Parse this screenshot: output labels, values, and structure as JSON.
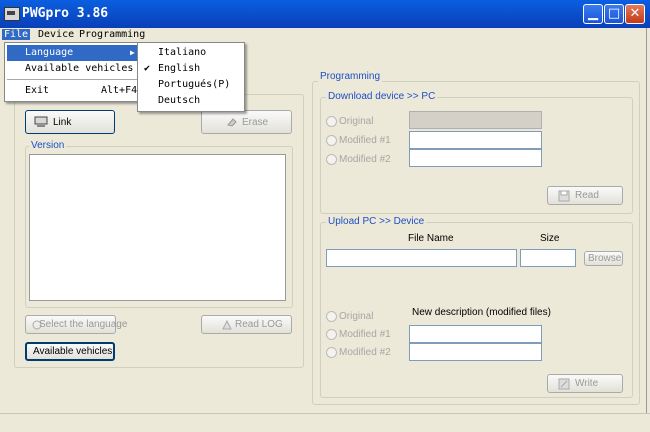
{
  "window": {
    "title": "PWGpro 3.86"
  },
  "menubar": {
    "file": "File",
    "device": "Device",
    "programming": "Programming"
  },
  "file_menu": {
    "language": "Language",
    "available_vehicles": "Available vehicles",
    "exit": "Exit",
    "exit_shortcut": "Alt+F4"
  },
  "language_menu": {
    "italiano": "Italiano",
    "english": "English",
    "portugues": "Portugués(P)",
    "deutsch": "Deutsch",
    "checked": "English"
  },
  "left": {
    "link": "Link",
    "erase": "Erase",
    "version_title": "Version",
    "select_language": "Select the language",
    "read_log": "Read LOG",
    "available_vehicles": "Available vehicles"
  },
  "programming": {
    "title": "Programming",
    "download": {
      "title": "Download device >> PC",
      "original": "Original",
      "modified1": "Modified #1",
      "modified2": "Modified #2",
      "read": "Read"
    },
    "upload": {
      "title": "Upload PC >> Device",
      "file_name": "File Name",
      "size": "Size",
      "browse": "Browse",
      "original": "Original",
      "new_description": "New description (modified files)",
      "modified1": "Modified #1",
      "modified2": "Modified #2",
      "write": "Write"
    }
  },
  "colors": {
    "titlebar": "#0a4fd0",
    "menu_highlight": "#316ac5",
    "group_title": "#1f4fc6",
    "window_bg": "#ece9d8"
  }
}
